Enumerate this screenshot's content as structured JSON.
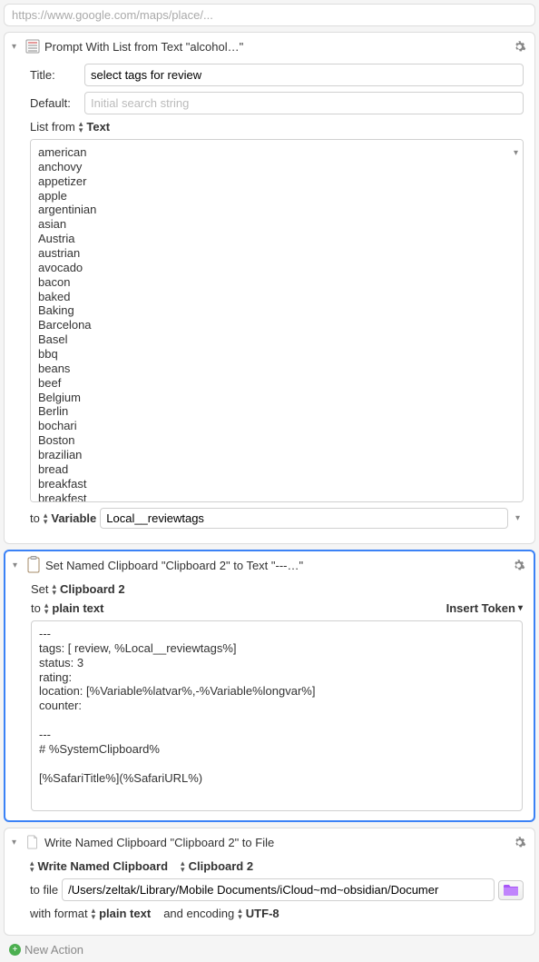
{
  "top_url": "https://www.google.com/maps/place/...",
  "block1": {
    "title": "Prompt With List from Text \"alcohol…\"",
    "label_title": "Title:",
    "label_default": "Default:",
    "label_listfrom": "List from",
    "title_value": "select tags for review",
    "default_placeholder": "Initial search string",
    "listfrom_token": "Text",
    "list_items": "american\nanchovy\nappetizer\napple\nargentinian\nasian\nAustria\naustrian\navocado\nbacon\nbaked\nBaking\nBarcelona\nBasel\nbbq\nbeans\nbeef\nBelgium\nBerlin\nbochari\nBoston\nbrazilian\nbread\nbreakfast\nbreakfest",
    "to_label": "to",
    "to_token": "Variable",
    "var_name": "Local__reviewtags"
  },
  "block2": {
    "title": "Set Named Clipboard \"Clipboard 2\" to Text \"---…\"",
    "set_label": "Set",
    "set_token": "Clipboard 2",
    "to_label": "to",
    "to_token": "plain text",
    "insert_token": "Insert Token",
    "content": "---\ntags: [ review, %Local__reviewtags%]\nstatus: 3\nrating:\nlocation: [%Variable%latvar%,-%Variable%longvar%]\ncounter:\n\n---\n# %SystemClipboard%\n\n[%SafariTitle%](%SafariURL%)"
  },
  "block3": {
    "title": "Write Named Clipboard \"Clipboard 2\" to File",
    "wnc_label": "Write Named Clipboard",
    "wnc_token": "Clipboard 2",
    "tofile_label": "to file",
    "file_path": "/Users/zeltak/Library/Mobile Documents/iCloud~md~obsidian/Documer",
    "fmt_label": "with format",
    "fmt_token": "plain text",
    "enc_label": "and encoding",
    "enc_token": "UTF-8"
  },
  "new_action": "New Action"
}
